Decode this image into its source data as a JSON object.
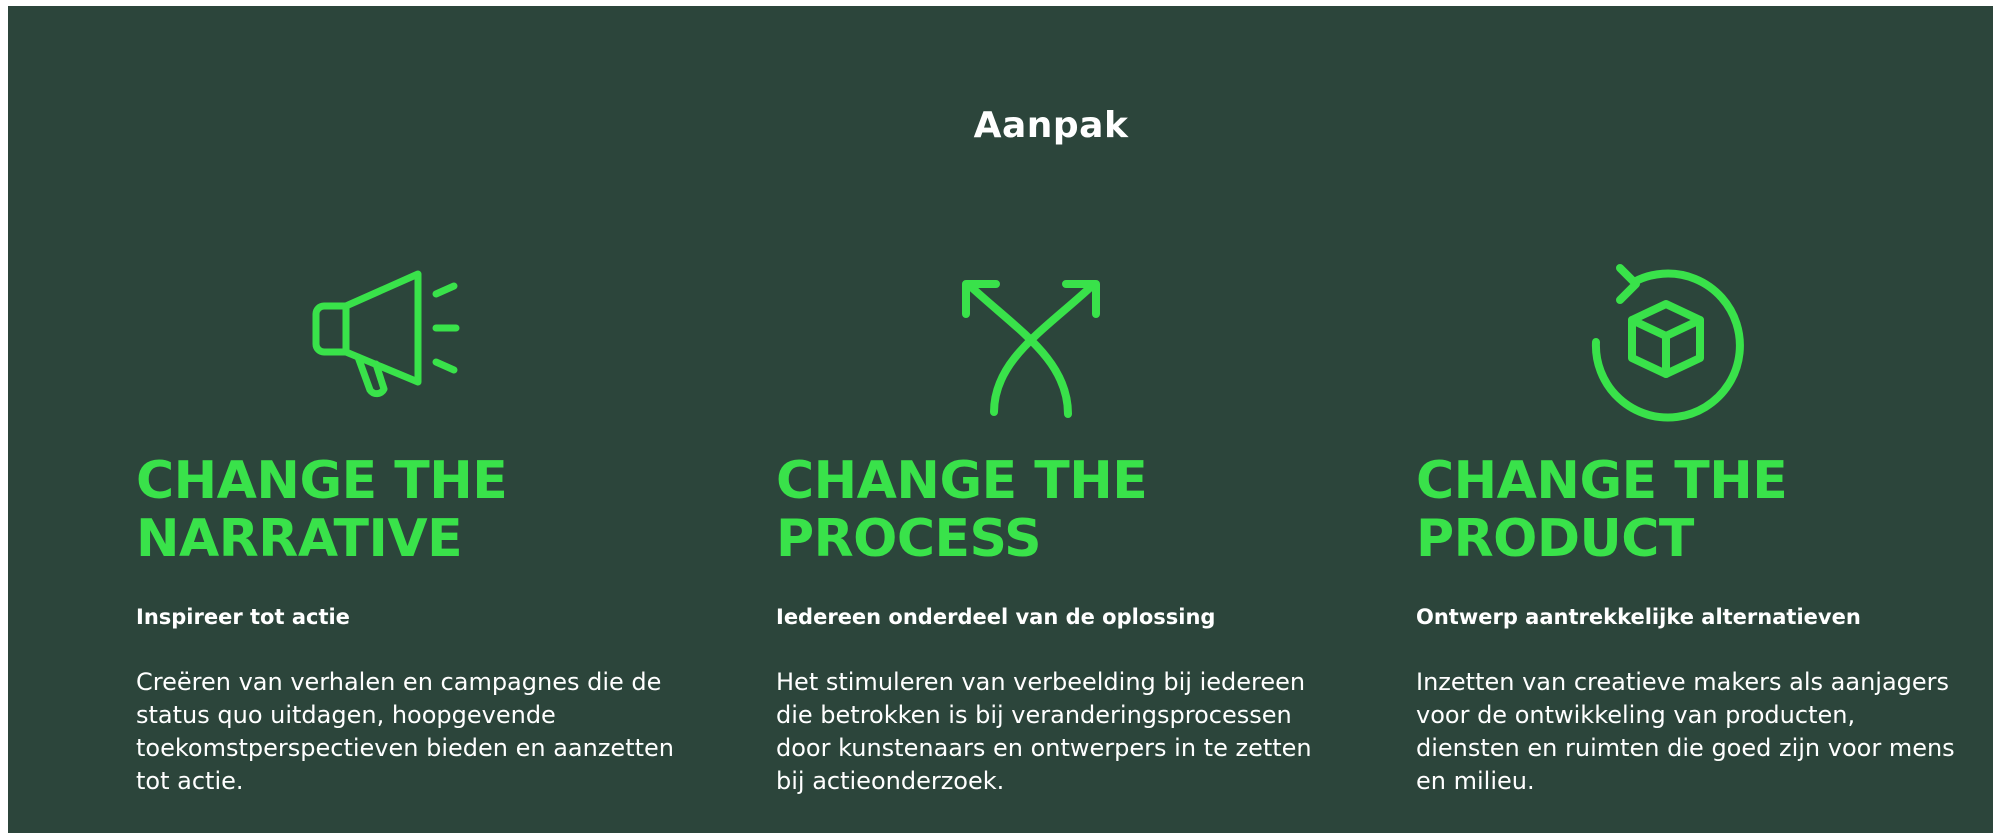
{
  "section": {
    "title": "Aanpak"
  },
  "colors": {
    "background": "#2c453b",
    "accent": "#39e24a",
    "text": "#ffffff"
  },
  "columns": [
    {
      "icon": "megaphone-icon",
      "heading_line1": "CHANGE THE",
      "heading_line2": "NARRATIVE",
      "subheading": "Inspireer tot actie",
      "body": "Creëren van verhalen en campagnes die de status quo uitdagen, hoopgevende toekomstperspectieven bieden en aanzetten tot actie."
    },
    {
      "icon": "diverging-arrows-icon",
      "heading_line1": "CHANGE THE",
      "heading_line2": "PROCESS",
      "subheading": "Iedereen onderdeel van de oplossing",
      "body": "Het stimuleren van verbeelding bij iedereen die betrokken is bij veranderingsprocessen door kunstenaars en ontwerpers in te zetten bij actieonderzoek."
    },
    {
      "icon": "box-cycle-icon",
      "heading_line1": "CHANGE THE",
      "heading_line2": "PRODUCT",
      "subheading": "Ontwerp aantrekkelijke alternatieven",
      "body": "Inzetten van creatieve makers als aanjagers voor de ontwikkeling van producten, diensten en ruimten die goed zijn voor mens en milieu."
    }
  ]
}
